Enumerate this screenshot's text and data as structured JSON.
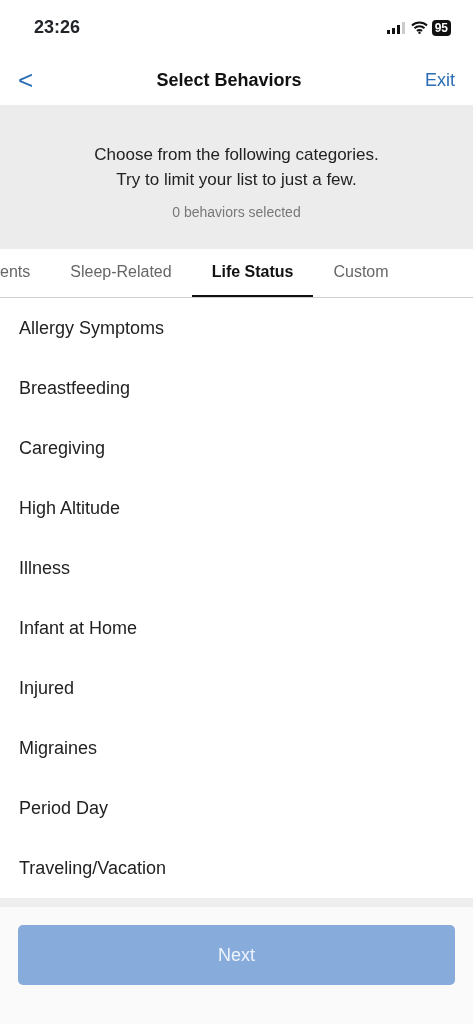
{
  "status_bar": {
    "time": "23:26",
    "battery": "95"
  },
  "nav": {
    "back": "<",
    "title": "Select Behaviors",
    "exit": "Exit"
  },
  "intro": {
    "line_1": "Choose from the following categories.",
    "line_2": "Try to limit your list to just a few.",
    "count": "0 behaviors selected"
  },
  "tabs": [
    {
      "label": "ents",
      "selected": false
    },
    {
      "label": "Sleep-Related",
      "selected": false
    },
    {
      "label": "Life Status",
      "selected": true
    },
    {
      "label": "Custom",
      "selected": false
    }
  ],
  "items": [
    "Allergy Symptoms",
    "Breastfeeding",
    "Caregiving",
    "High Altitude",
    "Illness",
    "Infant at Home",
    "Injured",
    "Migraines",
    "Period Day",
    "Traveling/Vacation"
  ],
  "next_button": {
    "label": "Next",
    "disabled": true
  }
}
